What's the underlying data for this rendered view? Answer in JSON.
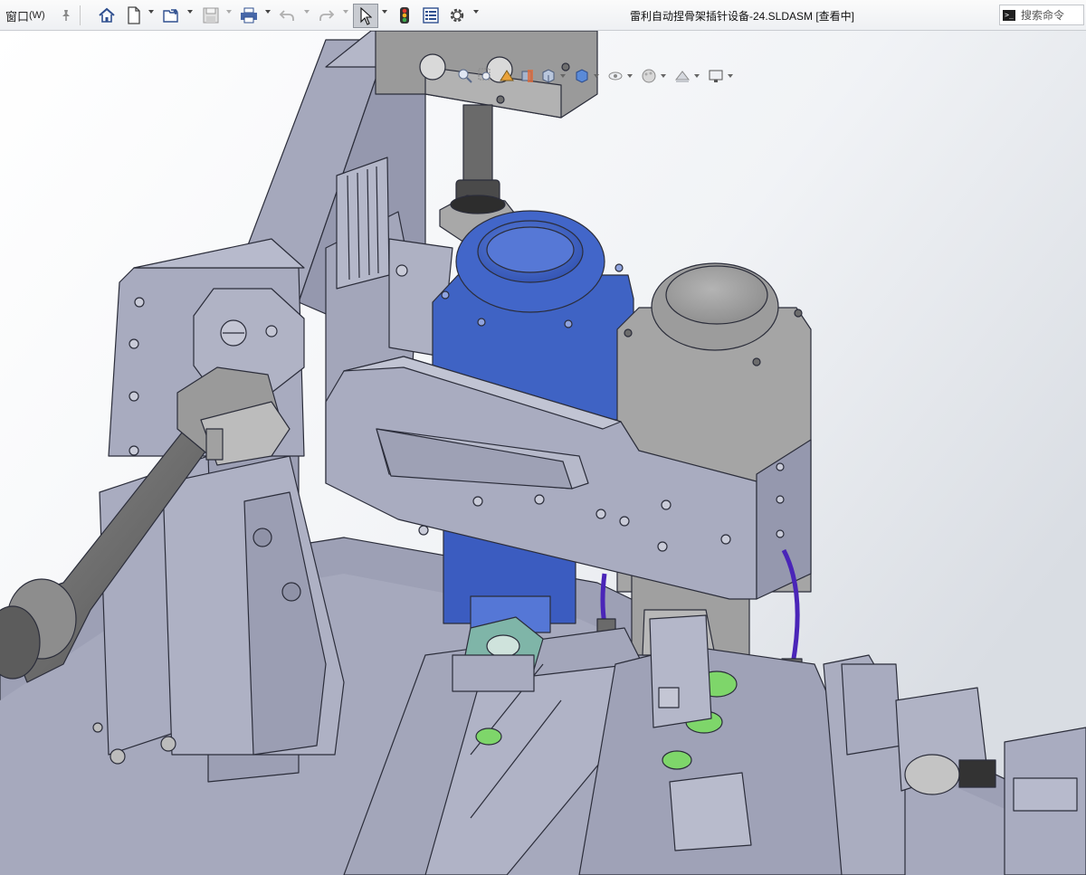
{
  "menu": {
    "window_label": "窗口",
    "window_shortcut": "(W)"
  },
  "document": {
    "title": "雷利自动捏骨架插针设备-24.SLDASM [查看中]"
  },
  "search": {
    "placeholder": "搜索命令"
  },
  "toolbar_icons": [
    "home-icon",
    "new-document-icon",
    "open-icon",
    "save-icon",
    "print-icon",
    "undo-icon",
    "redo-icon",
    "select-pointer-icon",
    "traffic-light-icon",
    "file-properties-icon",
    "gear-icon"
  ],
  "heads_up_icons": [
    "zoom-to-fit-icon",
    "zoom-to-area-icon",
    "previous-view-icon",
    "section-view-icon",
    "view-orientation-icon",
    "display-style-icon",
    "hide-show-items-icon",
    "edit-appearance-icon",
    "apply-scene-icon",
    "view-settings-icon"
  ],
  "colors": {
    "part_gray_blue": "#a8abbf",
    "motor_blue": "#3f63c4",
    "motor_gray": "#a6a6a6",
    "cable_purple": "#4a25b8",
    "tooling_green": "#7ed66a",
    "teal_part": "#7fb5a8"
  }
}
